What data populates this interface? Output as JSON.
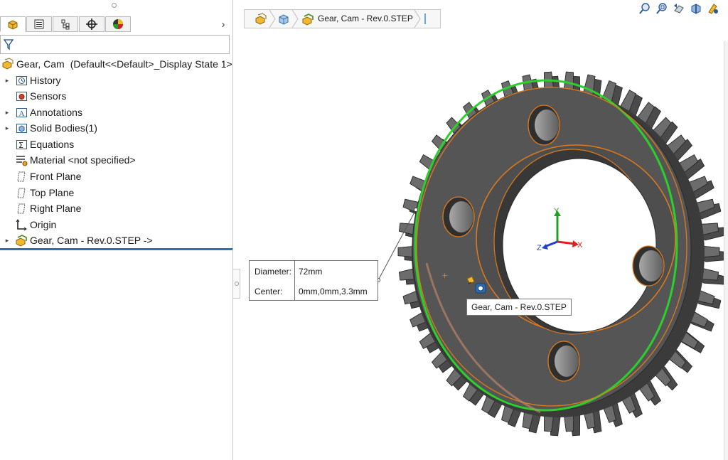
{
  "colors": {
    "gear_face": "#5a5a5a",
    "gear_dark": "#3d3d3d",
    "gear_tooth": "#6c6c6c",
    "edge_highlight": "#2ccf2c",
    "edge_preselect": "#e07a1a",
    "rollback_bar": "#2f6fae",
    "axis_x": "#e02020",
    "axis_y": "#20a020",
    "axis_z": "#2040d0"
  },
  "manager_tabs": [
    {
      "name": "featuremanager",
      "icon": "part-icon",
      "active": true
    },
    {
      "name": "propertymanager",
      "icon": "propertymanager-icon",
      "active": false
    },
    {
      "name": "configurationmanager",
      "icon": "configuration-icon",
      "active": false
    },
    {
      "name": "dimxpertmanager",
      "icon": "crosshair-icon",
      "active": false
    },
    {
      "name": "displaymanager",
      "icon": "appearance-icon",
      "active": false
    }
  ],
  "tabs_scroll_glyph": "›",
  "feature_tree": {
    "root": {
      "label": "Gear, Cam",
      "config": "(Default<<Default>_Display State 1>"
    },
    "items": [
      {
        "label": "History",
        "icon": "history-icon",
        "expandable": true
      },
      {
        "label": "Sensors",
        "icon": "sensors-icon",
        "expandable": false
      },
      {
        "label": "Annotations",
        "icon": "annotations-icon",
        "expandable": true
      },
      {
        "label": "Solid Bodies(1)",
        "icon": "solid-bodies-icon",
        "expandable": true
      },
      {
        "label": "Equations",
        "icon": "equations-icon",
        "expandable": false
      },
      {
        "label": "Material <not specified>",
        "icon": "material-icon",
        "expandable": false
      },
      {
        "label": "Front Plane",
        "icon": "plane-icon",
        "expandable": false
      },
      {
        "label": "Top Plane",
        "icon": "plane-icon",
        "expandable": false
      },
      {
        "label": "Right Plane",
        "icon": "plane-icon",
        "expandable": false
      },
      {
        "label": "Origin",
        "icon": "origin-icon",
        "expandable": false
      },
      {
        "label": "Gear, Cam - Rev.0.STEP ->",
        "icon": "imported-feature-icon",
        "expandable": true
      }
    ]
  },
  "breadcrumb": {
    "label": "Gear, Cam - Rev.0.STEP",
    "icons": [
      "part-icon",
      "solid-body-icon",
      "imported-feature-icon"
    ]
  },
  "view_toolbar": {
    "icons": [
      "zoom-to-fit-icon",
      "zoom-to-area-icon",
      "previous-view-icon",
      "section-view-icon",
      "dynamic-annotation-icon"
    ]
  },
  "measure_callout": {
    "rows": [
      {
        "label": "Diameter:",
        "value": "72mm"
      },
      {
        "label": "Center:",
        "value": "0mm,0mm,3.3mm"
      }
    ]
  },
  "hover_tooltip": "Gear, Cam - Rev.0.STEP",
  "triad": {
    "x": "X",
    "y": "Y",
    "z": "Z"
  }
}
